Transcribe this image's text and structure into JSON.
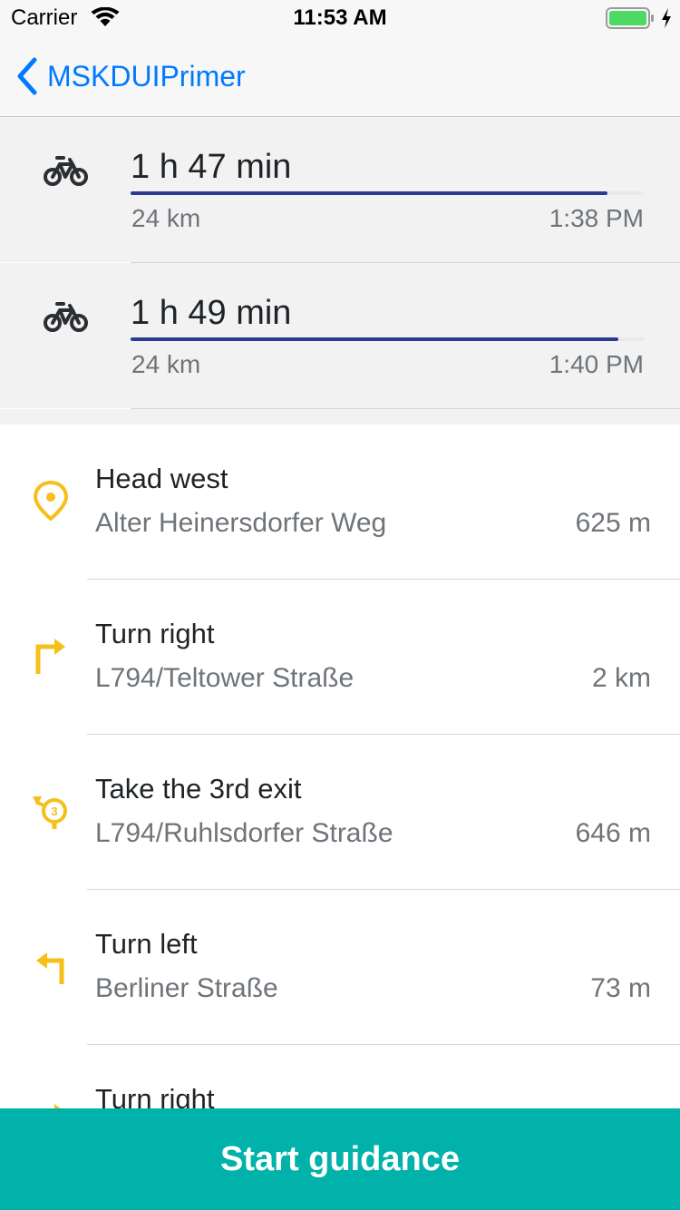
{
  "status_bar": {
    "carrier": "Carrier",
    "time": "11:53 AM",
    "battery_color": "#4cd964"
  },
  "nav": {
    "back_label": "MSKDUIPrimer",
    "accent": "#007aff"
  },
  "routes": [
    {
      "icon": "bicycle-icon",
      "duration": "1 h 47 min",
      "distance": "24 km",
      "arrival": "1:38 PM",
      "progress": 0.93
    },
    {
      "icon": "bicycle-icon",
      "duration": "1 h 49 min",
      "distance": "24 km",
      "arrival": "1:40 PM",
      "progress": 0.95
    }
  ],
  "instructions": [
    {
      "icon": "location-pin-icon",
      "title": "Head west",
      "street": "Alter Heinersdorfer Weg",
      "distance": "625 m"
    },
    {
      "icon": "turn-right-icon",
      "title": "Turn right",
      "street": "L794/Teltower Straße",
      "distance": "2 km"
    },
    {
      "icon": "roundabout-exit-3-icon",
      "title": "Take the 3rd exit",
      "street": "L794/Ruhlsdorfer Straße",
      "distance": "646 m",
      "exit_number": "3"
    },
    {
      "icon": "turn-left-icon",
      "title": "Turn left",
      "street": "Berliner Straße",
      "distance": "73 m"
    },
    {
      "icon": "turn-right-icon",
      "title": "Turn right",
      "street": "",
      "distance": ""
    }
  ],
  "start_button": {
    "label": "Start guidance",
    "color": "#00b2a9"
  },
  "colors": {
    "route_line": "#2a3a8e",
    "maneuver_icon": "#f5c01a"
  }
}
